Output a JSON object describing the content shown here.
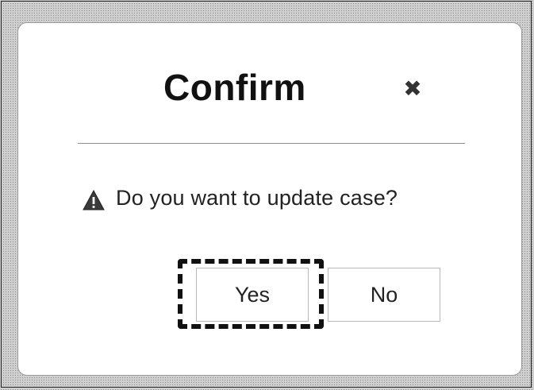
{
  "dialog": {
    "title": "Confirm",
    "close_glyph": "✖",
    "message": "Do you want to update case?",
    "message_icon": "warning-icon",
    "buttons": {
      "yes_label": "Yes",
      "no_label": "No"
    },
    "focused_button": "yes"
  }
}
